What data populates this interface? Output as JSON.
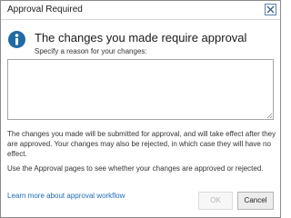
{
  "dialog": {
    "title": "Approval Required",
    "close_icon": "close-icon",
    "info_icon": "info-icon",
    "heading": "The changes you made require approval",
    "prompt": "Specify a reason for your changes:",
    "reason_value": "",
    "paragraph1": "The changes you made will be submitted for approval, and will take effect after they are approved. Your changes may also be rejected, in which case they will have no effect.",
    "paragraph2": "Use the Approval pages to see whether your changes are approved or rejected.",
    "learn_more_link": "Learn more about approval workflow",
    "ok_label": "OK",
    "ok_enabled": false,
    "cancel_label": "Cancel"
  },
  "colors": {
    "accent": "#1f6aa5",
    "link": "#1e6bb8",
    "close_border": "#5a7fb0"
  }
}
